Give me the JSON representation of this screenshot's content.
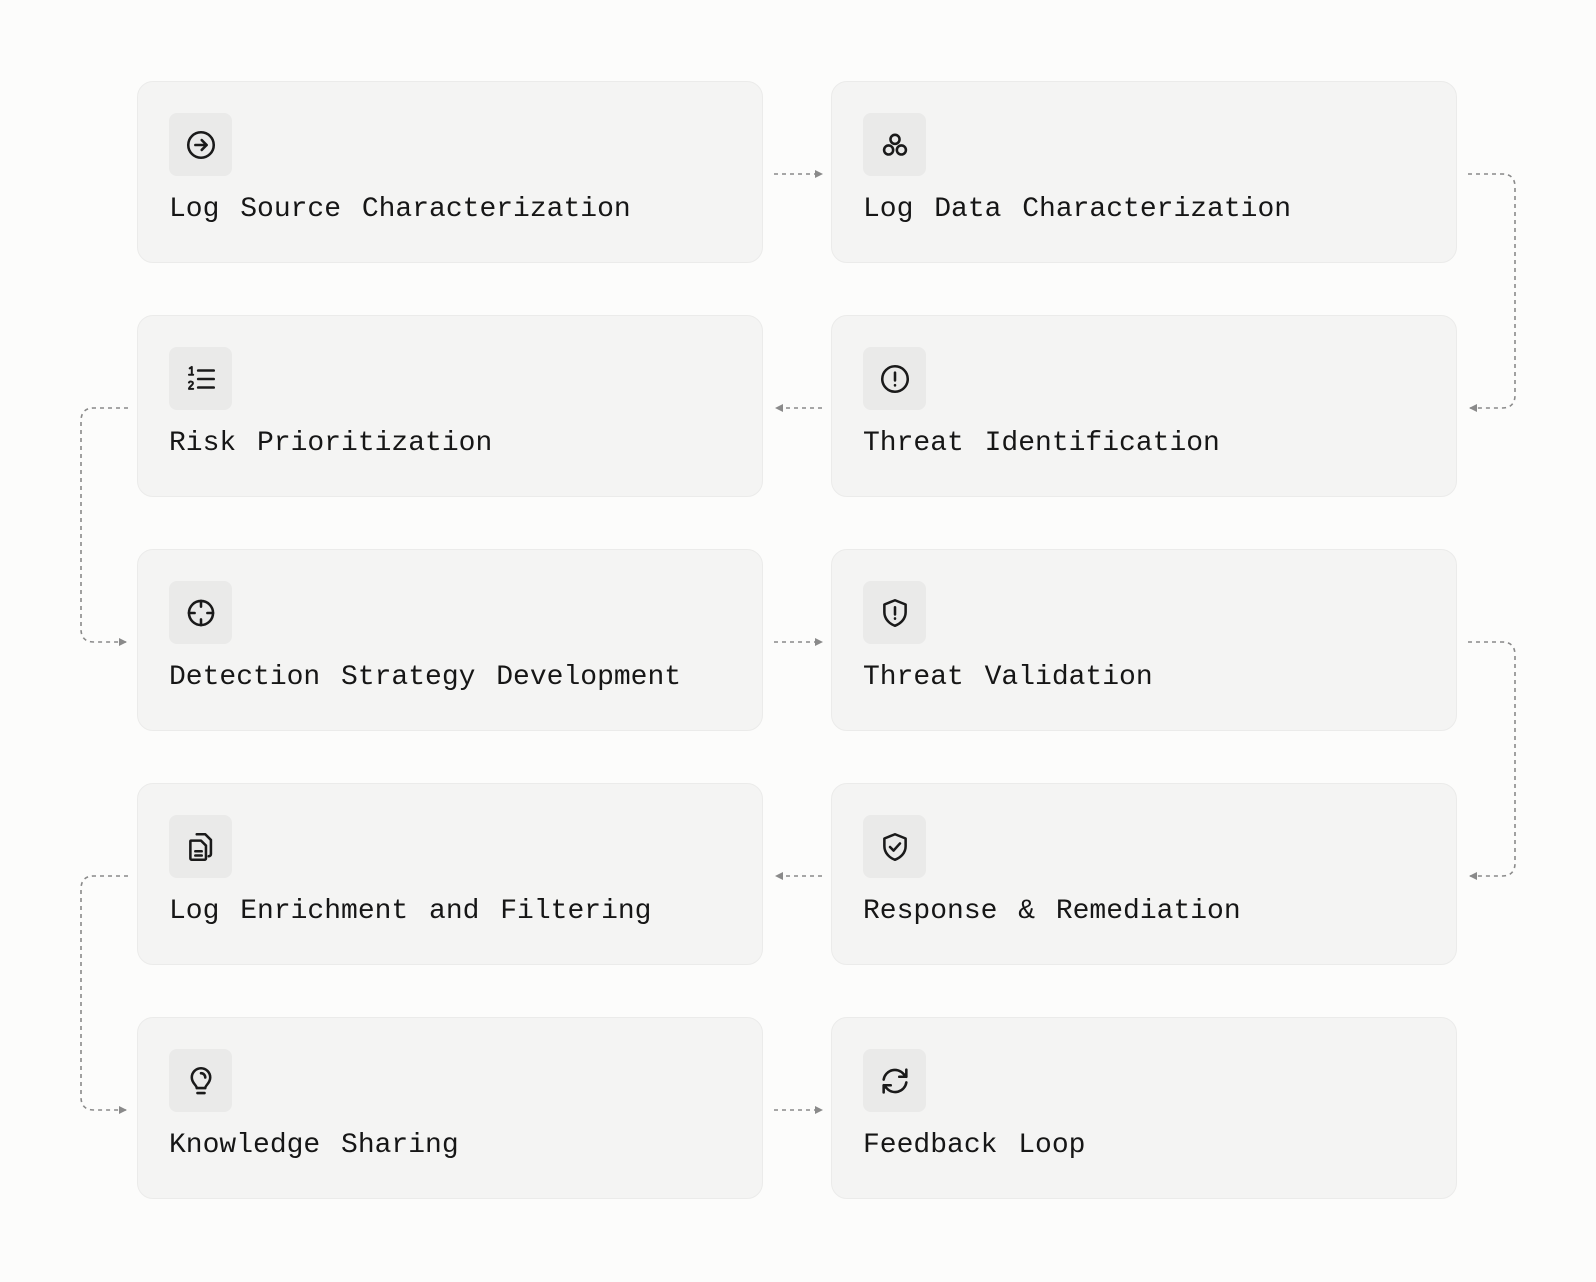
{
  "steps": [
    {
      "label": "Log Source Characterization",
      "icon": "circle-arrow-right-icon"
    },
    {
      "label": "Log Data Characterization",
      "icon": "circles-cluster-icon"
    },
    {
      "label": "Risk Prioritization",
      "icon": "numbered-list-icon"
    },
    {
      "label": "Threat Identification",
      "icon": "alert-circle-icon"
    },
    {
      "label": "Detection Strategy Development",
      "icon": "crosshair-icon"
    },
    {
      "label": "Threat Validation",
      "icon": "shield-alert-icon"
    },
    {
      "label": "Log Enrichment and Filtering",
      "icon": "files-icon"
    },
    {
      "label": "Response & Remediation",
      "icon": "shield-check-icon"
    },
    {
      "label": "Knowledge Sharing",
      "icon": "lightbulb-icon"
    },
    {
      "label": "Feedback Loop",
      "icon": "refresh-icon"
    }
  ],
  "colors": {
    "card": "#f4f4f3",
    "connector": "#8a8a8a",
    "text": "#161616"
  }
}
